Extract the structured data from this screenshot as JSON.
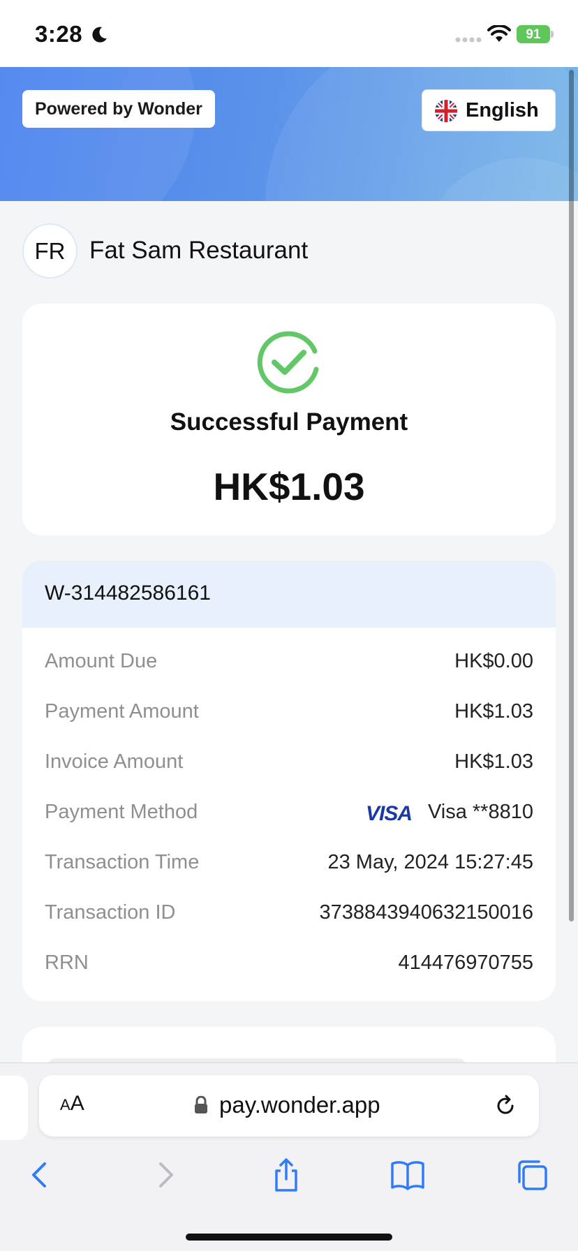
{
  "status_bar": {
    "time": "3:28",
    "battery": "91"
  },
  "header": {
    "powered_by": "Powered by Wonder",
    "language": "English"
  },
  "merchant": {
    "initials": "FR",
    "name": "Fat Sam Restaurant"
  },
  "result": {
    "title": "Successful Payment",
    "amount": "HK$1.03"
  },
  "details": {
    "order_id": "W-314482586161",
    "rows": [
      {
        "label": "Amount Due",
        "value": "HK$0.00"
      },
      {
        "label": "Payment Amount",
        "value": "HK$1.03"
      },
      {
        "label": "Invoice Amount",
        "value": "HK$1.03"
      },
      {
        "label": "Payment Method",
        "value": "Visa **8810",
        "brand": "VISA"
      },
      {
        "label": "Transaction Time",
        "value": "23 May, 2024 15:27:45"
      },
      {
        "label": "Transaction ID",
        "value": "3738843940632150016"
      },
      {
        "label": "RRN",
        "value": "414476970755"
      }
    ]
  },
  "browser": {
    "url": "pay.wonder.app",
    "text_size": "AA",
    "toolbar": [
      "back-icon",
      "forward-icon",
      "share-icon",
      "bookmarks-icon",
      "tabs-icon"
    ]
  },
  "colors": {
    "success": "#62c766",
    "visa": "#1a3aa3",
    "hero_start": "#4a82ee",
    "hero_end": "#78b6e8"
  }
}
